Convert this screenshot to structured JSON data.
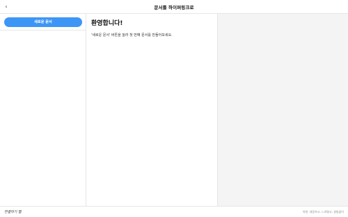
{
  "header": {
    "back_icon": "chevron-left-icon",
    "back_glyph": "‹",
    "title": "문서를 하이퍼링크로"
  },
  "sidebar": {
    "new_document_label": "새로운 문서"
  },
  "main": {
    "welcome_title": "환영합니다!",
    "welcome_text": "'새로운 문서' 버튼을 눌러 첫 번째 문서를 만들어보세요."
  },
  "footer": {
    "brand": "연결하기 웹",
    "links": "약관, 대응하고, 느려졌고, 쌍방없이"
  },
  "colors": {
    "accent": "#3d96f5",
    "border": "#e6e6e6",
    "preview_bg": "#f4f4f4"
  }
}
